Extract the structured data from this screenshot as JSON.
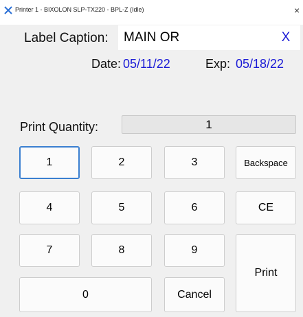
{
  "window": {
    "title": "Printer 1 - BIXOLON SLP-TX220 - BPL-Z (Idle)",
    "close_glyph": "×"
  },
  "caption": {
    "label": "Label Caption:",
    "value": "MAIN OR",
    "clear_label": "X"
  },
  "dates": {
    "date_label": "Date:",
    "date_value": "05/11/22",
    "exp_label": "Exp:",
    "exp_value": "05/18/22"
  },
  "quantity": {
    "label": "Print Quantity:",
    "value": "1"
  },
  "keypad": {
    "k1": "1",
    "k2": "2",
    "k3": "3",
    "backspace": "Backspace",
    "k4": "4",
    "k5": "5",
    "k6": "6",
    "ce": "CE",
    "k7": "7",
    "k8": "8",
    "k9": "9",
    "print": "Print",
    "k0": "0",
    "cancel": "Cancel"
  },
  "icons": {
    "app": "printer-app-icon",
    "close": "close-icon",
    "clear": "clear-x-icon"
  },
  "colors": {
    "accent_blue": "#1a1ad6",
    "focus_border": "#3a7fd0",
    "panel_bg": "#f0f0f0"
  }
}
